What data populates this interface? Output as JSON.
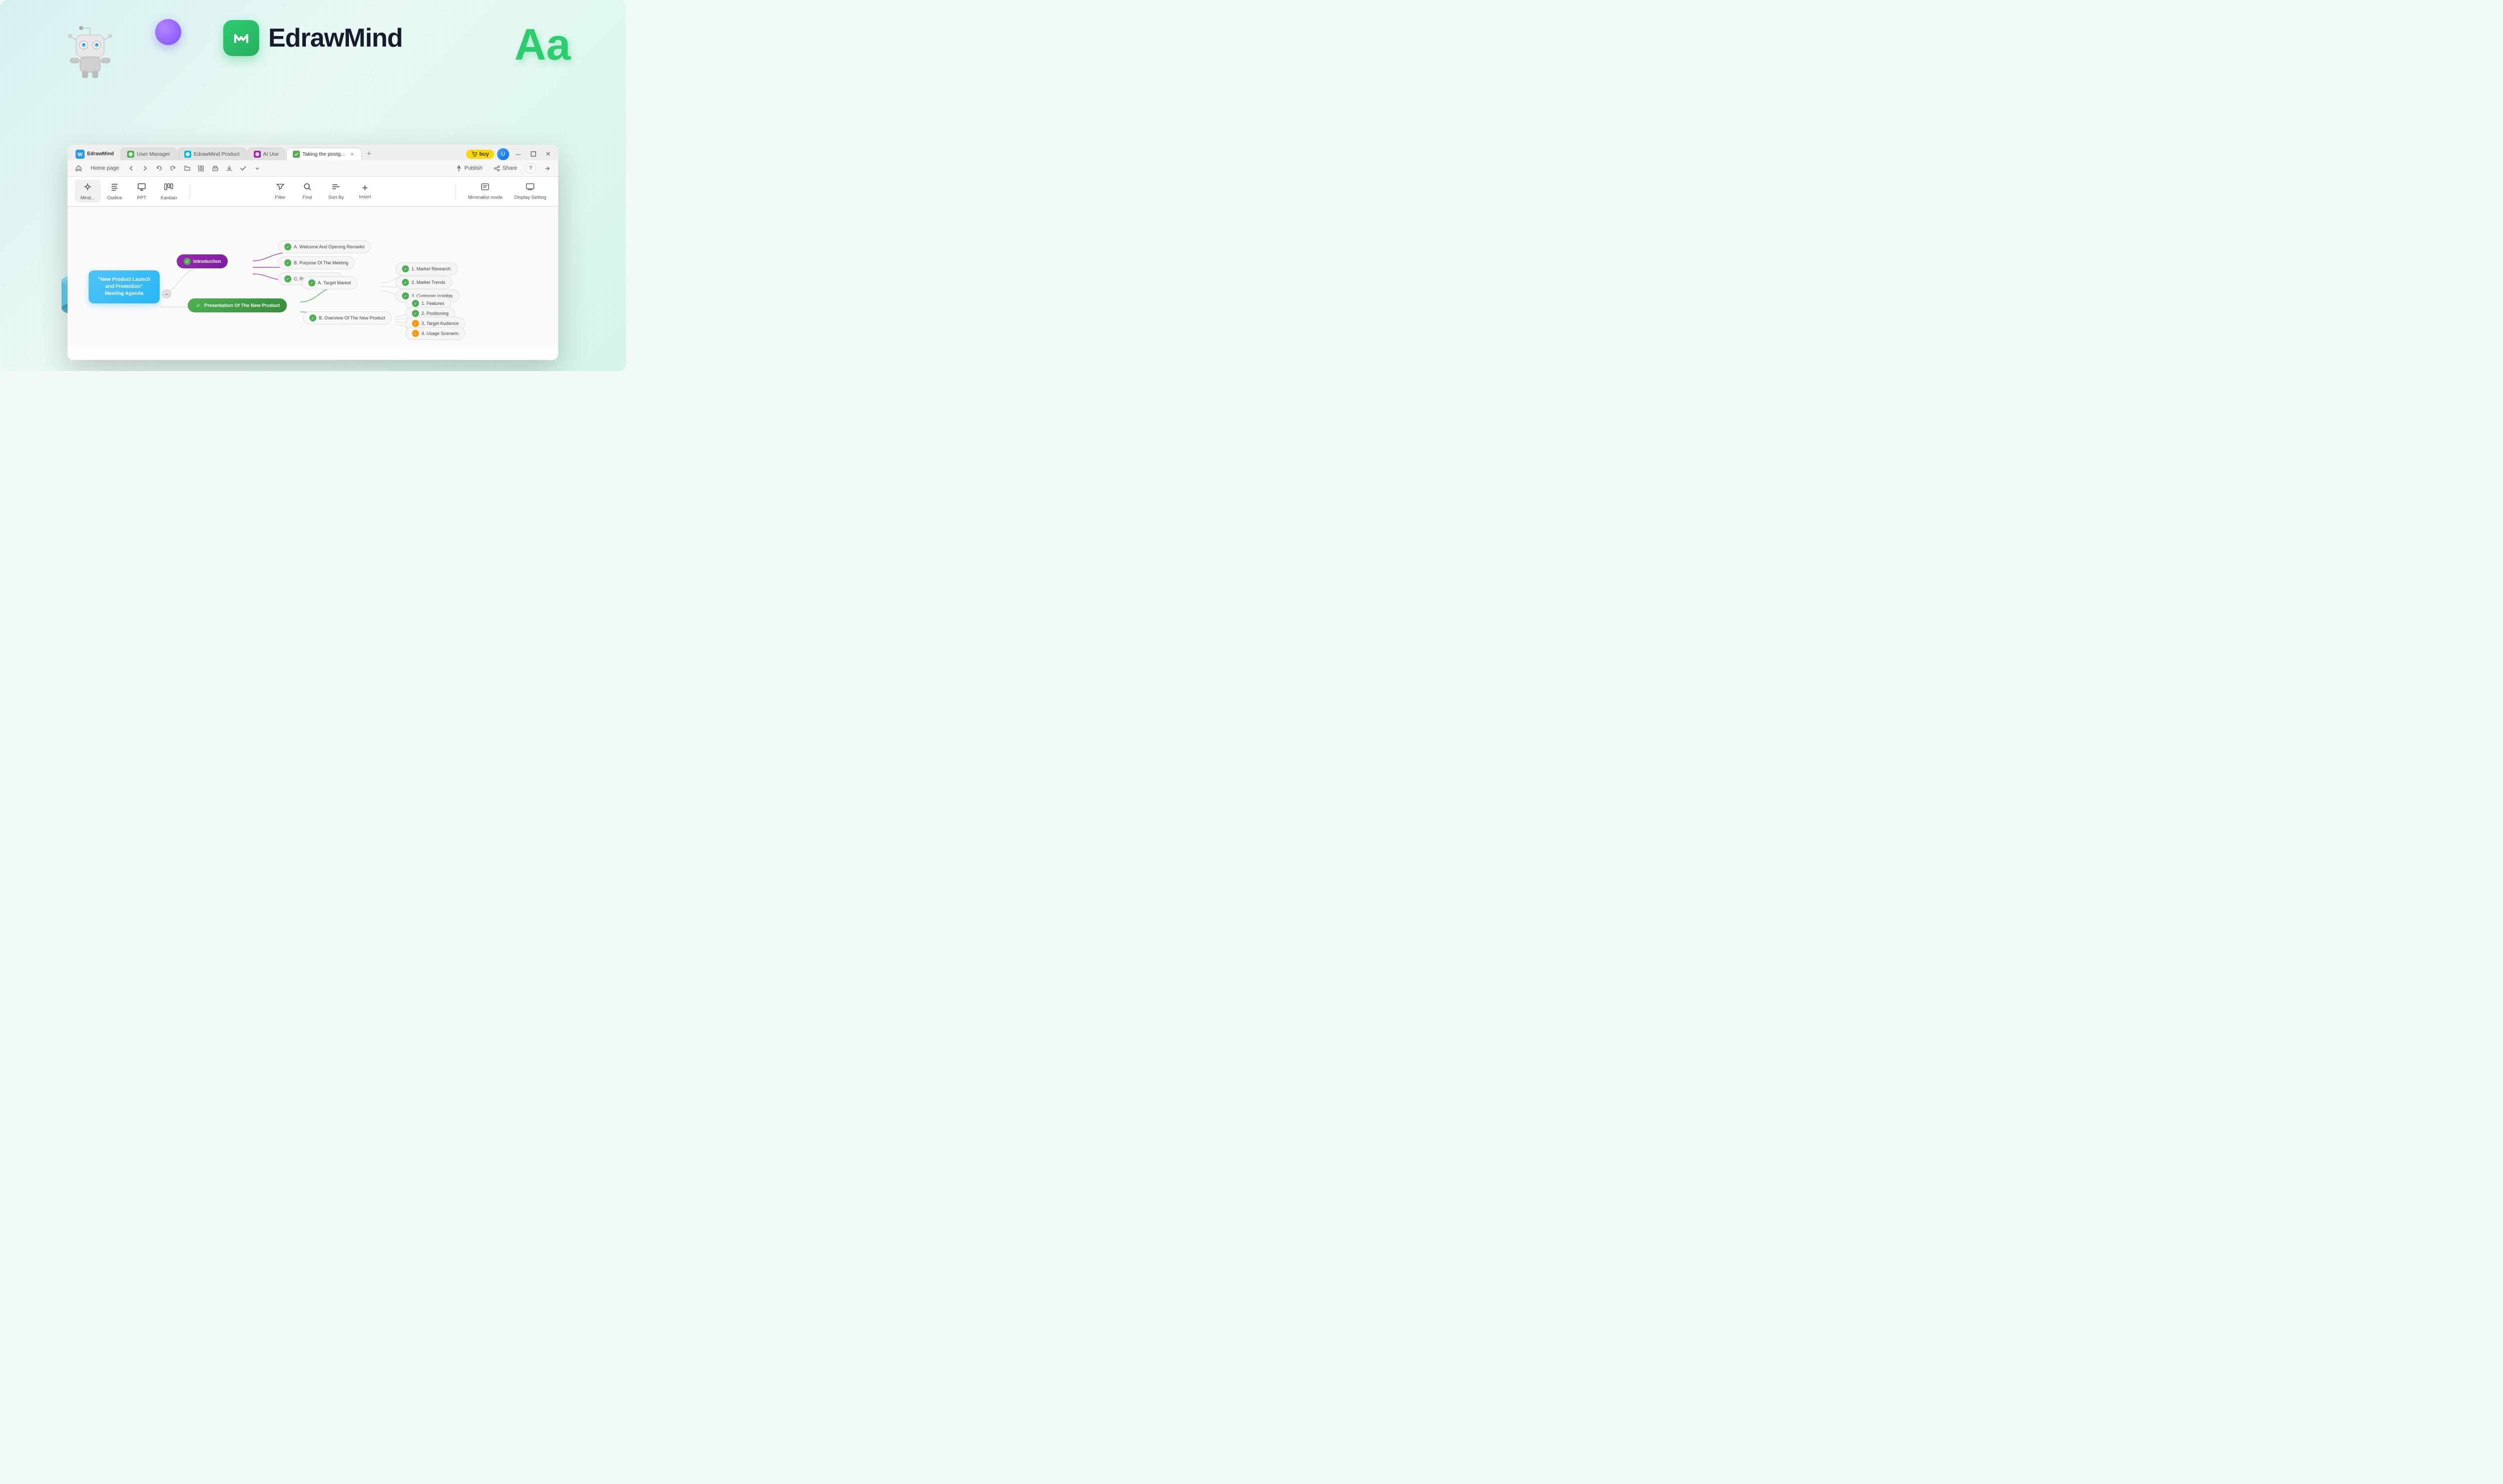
{
  "app": {
    "name": "EdrawMind",
    "logo_text": "EdrawMind"
  },
  "tabs": [
    {
      "id": "user-manager",
      "label": "User Manager",
      "color": "#4caf50",
      "active": false
    },
    {
      "id": "edrawmind-product",
      "label": "EdrawMind Product",
      "color": "#00bcd4",
      "active": false
    },
    {
      "id": "ai-use",
      "label": "AI Use",
      "color": "#9c27b0",
      "active": false
    },
    {
      "id": "taking-the-postg",
      "label": "Taking the postg...",
      "color": "#4caf50",
      "active": true
    }
  ],
  "header": {
    "home_page": "Home page",
    "buy_label": "buy",
    "publish_label": "Publish",
    "share_label": "Share"
  },
  "toolbar": {
    "mind_label": "Mind...",
    "outline_label": "Outline",
    "ppt_label": "PPT",
    "kanban_label": "Kanban",
    "filter_label": "Filter",
    "find_label": "Find",
    "sort_by_label": "Sort By",
    "insert_label": "Insert",
    "minimalist_mode_label": "Minimalist mode",
    "display_setting_label": "Display Setting"
  },
  "mindmap": {
    "central_node": "\"New Product Launch and Promotion\" Meeting Agenda",
    "introduction_label": "Introduction",
    "nodes": [
      {
        "id": "welcome",
        "label": "A. Welcome And Opening Remarks",
        "type": "leaf"
      },
      {
        "id": "purpose",
        "label": "B. Purpose Of The Meeting",
        "type": "leaf"
      },
      {
        "id": "review",
        "label": "C. Review Of Agenda",
        "type": "leaf"
      },
      {
        "id": "target_market",
        "label": "A. Target Market",
        "type": "mid"
      },
      {
        "id": "market_research",
        "label": "1. Market Research",
        "type": "leaf"
      },
      {
        "id": "market_trends",
        "label": "2. Market Trends",
        "type": "leaf"
      },
      {
        "id": "customer_insights",
        "label": "3. Customer Insights",
        "type": "leaf"
      },
      {
        "id": "presentation",
        "label": "Presentation Of The New Product",
        "type": "green"
      },
      {
        "id": "overview",
        "label": "B. Overview Of The New Product",
        "type": "mid"
      },
      {
        "id": "features",
        "label": "1. Features",
        "type": "leaf"
      },
      {
        "id": "positioning",
        "label": "2. Positioning",
        "type": "leaf"
      },
      {
        "id": "target_audience",
        "label": "3. Target Audience",
        "type": "leaf"
      },
      {
        "id": "usage_scenario",
        "label": "4. Usage Scenario",
        "type": "leaf"
      }
    ]
  }
}
